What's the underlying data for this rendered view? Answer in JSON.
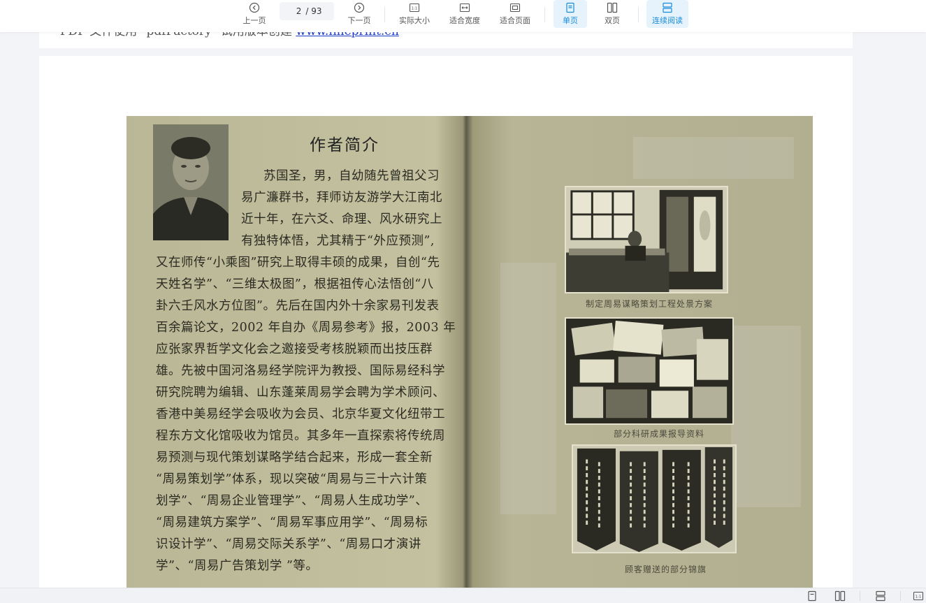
{
  "toolbar": {
    "prev_label": "上一页",
    "current_page": "2",
    "total_pages": "/ 93",
    "next_label": "下一页",
    "actual_size_label": "实际大小",
    "fit_width_label": "适合宽度",
    "fit_page_label": "适合页面",
    "single_page_label": "单页",
    "double_page_label": "双页",
    "continuous_label": "连续阅读",
    "actual_size_glyph": "1:1"
  },
  "page1": {
    "text_prefix": "PDF 文件使用 \"pdfFactory\" 试用版本创建 ",
    "link": "www.fineprint.cn"
  },
  "scan": {
    "title": "作者简介",
    "bio_lines": [
      "苏国圣，男，自幼随先曾祖父习",
      "易广濂群书，拜师访友游学大江南北",
      "近十年，在六爻、命理、风水研究上",
      "有独特体悟，尤其精于“外应预测”,",
      "又在师传“小乘图”研究上取得丰硕的成果，自创“先",
      "天姓名学”、“三维太极图”，根据祖传心法悟创“八",
      "卦六壬风水方位图”。先后在国内外十余家易刊发表",
      "百余篇论文，2002 年自办《周易参考》报，2003 年",
      "应张家界哲学文化会之邀接受考核脱颖而出技压群",
      "雄。先被中国河洛易经学院评为教授、国际易经科学",
      "研究院聘为编辑、山东蓬莱周易学会聘为学术顾问、",
      "香港中美易经学会吸收为会员、北京华夏文化纽带工",
      "程东方文化馆吸收为馆员。其多年一直探索将传统周",
      "易预测与现代策划谋略学结合起来，形成一套全新",
      "“周易策划学”体系，现以突破“周易与三十六计策",
      "划学”、“周易企业管理学”、“周易人生成功学”、",
      "“周易建筑方案学”、“周易军事应用学”、“周易标",
      "识设计学”、“周易交际关系学”、“周易口才演讲",
      "学”、“周易广告策划学 ”等。"
    ],
    "captions": [
      "制定周易谋略策划工程处景方案",
      "部分科研成果报导资料",
      "顾客赠送的部分锦旗"
    ]
  },
  "colors": {
    "accent": "#1a8cd8",
    "accent_bg": "#e6f3fd",
    "link": "#1a3cc8"
  }
}
